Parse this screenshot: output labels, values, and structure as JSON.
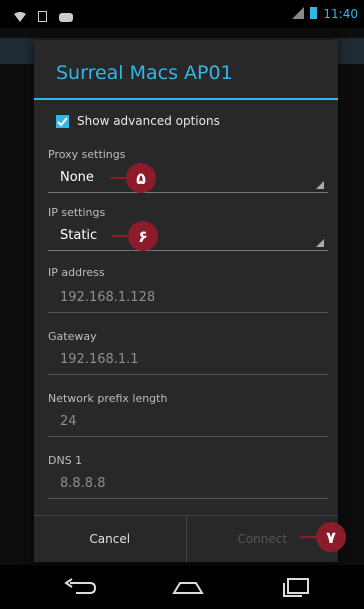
{
  "status_bar": {
    "time": "11:40"
  },
  "dialog": {
    "title": "Surreal Macs AP01",
    "show_advanced": {
      "label": "Show advanced options",
      "checked": true
    },
    "proxy": {
      "label": "Proxy settings",
      "value": "None"
    },
    "ip_settings": {
      "label": "IP settings",
      "value": "Static"
    },
    "ip_address": {
      "label": "IP address",
      "value": "192.168.1.128"
    },
    "gateway": {
      "label": "Gateway",
      "value": "192.168.1.1"
    },
    "prefix": {
      "label": "Network prefix length",
      "value": "24"
    },
    "dns1": {
      "label": "DNS 1",
      "value": "8.8.8.8"
    },
    "buttons": {
      "cancel": "Cancel",
      "connect": "Connect"
    }
  },
  "annotations": {
    "m5": "۵",
    "m6": "۶",
    "m7": "۷"
  },
  "colors": {
    "accent": "#33b5e5",
    "marker": "#8a1c2b"
  }
}
